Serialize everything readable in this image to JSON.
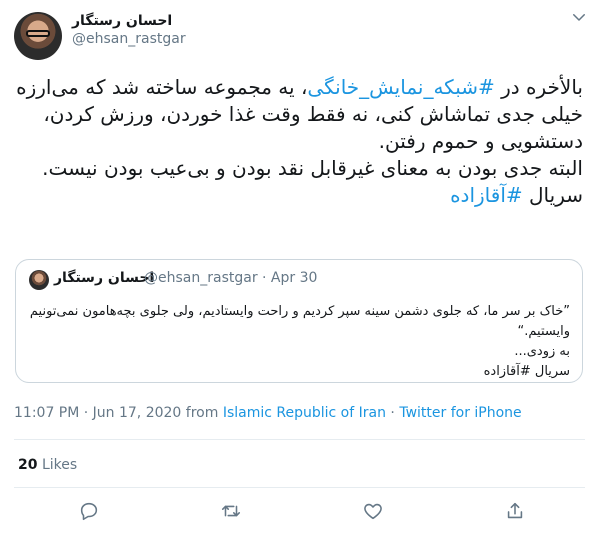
{
  "author": {
    "display_name": "احسان رستگار",
    "handle": "@ehsan_rastgar"
  },
  "tweet": {
    "lines": [
      {
        "parts": [
          {
            "text": "بالأخره در ",
            "tag": false
          },
          {
            "text": "#شبکه_نمایش_خانگی",
            "tag": true
          },
          {
            "text": "، یه مجموعه ساخته شد که می‌ارزه خیلی جدی تماشاش کنی، نه فقط وقت غذا خوردن، ورزش کردن، دستشویی و حموم رفتن.",
            "tag": false
          }
        ]
      },
      {
        "parts": [
          {
            "text": "البته جدی بودن به معنای غیرقابل نقد بودن و بی‌عیب بودن نیست.",
            "tag": false
          }
        ]
      },
      {
        "parts": [
          {
            "text": "سریال ",
            "tag": false
          },
          {
            "text": "#آقازاده",
            "tag": true
          }
        ]
      }
    ]
  },
  "quoted": {
    "display_name": "احسان رستگار",
    "handle_date": "@ehsan_rastgar · Apr 30",
    "lines": [
      "”خاک بر سر ما، که جلوی دشمن سینه سپر کردیم و راحت وایستادیم، ولی جلوی بچه‌هامون نمی‌تونیم وایستیم.“",
      "به زودی...",
      "سریال #آقازاده"
    ]
  },
  "meta": {
    "time_date": "11:07 PM · Jun 17, 2020 from ",
    "location": "Islamic Republic of Iran",
    "separator": " · ",
    "source": "Twitter for iPhone"
  },
  "engagement": {
    "likes_count": "20",
    "likes_label": "Likes"
  },
  "colors": {
    "link": "#1b95e0",
    "secondary_text": "#657786",
    "border": "#e6ecf0"
  },
  "icons": [
    "chevron-down-icon",
    "reply-icon",
    "retweet-icon",
    "like-icon",
    "share-icon"
  ]
}
